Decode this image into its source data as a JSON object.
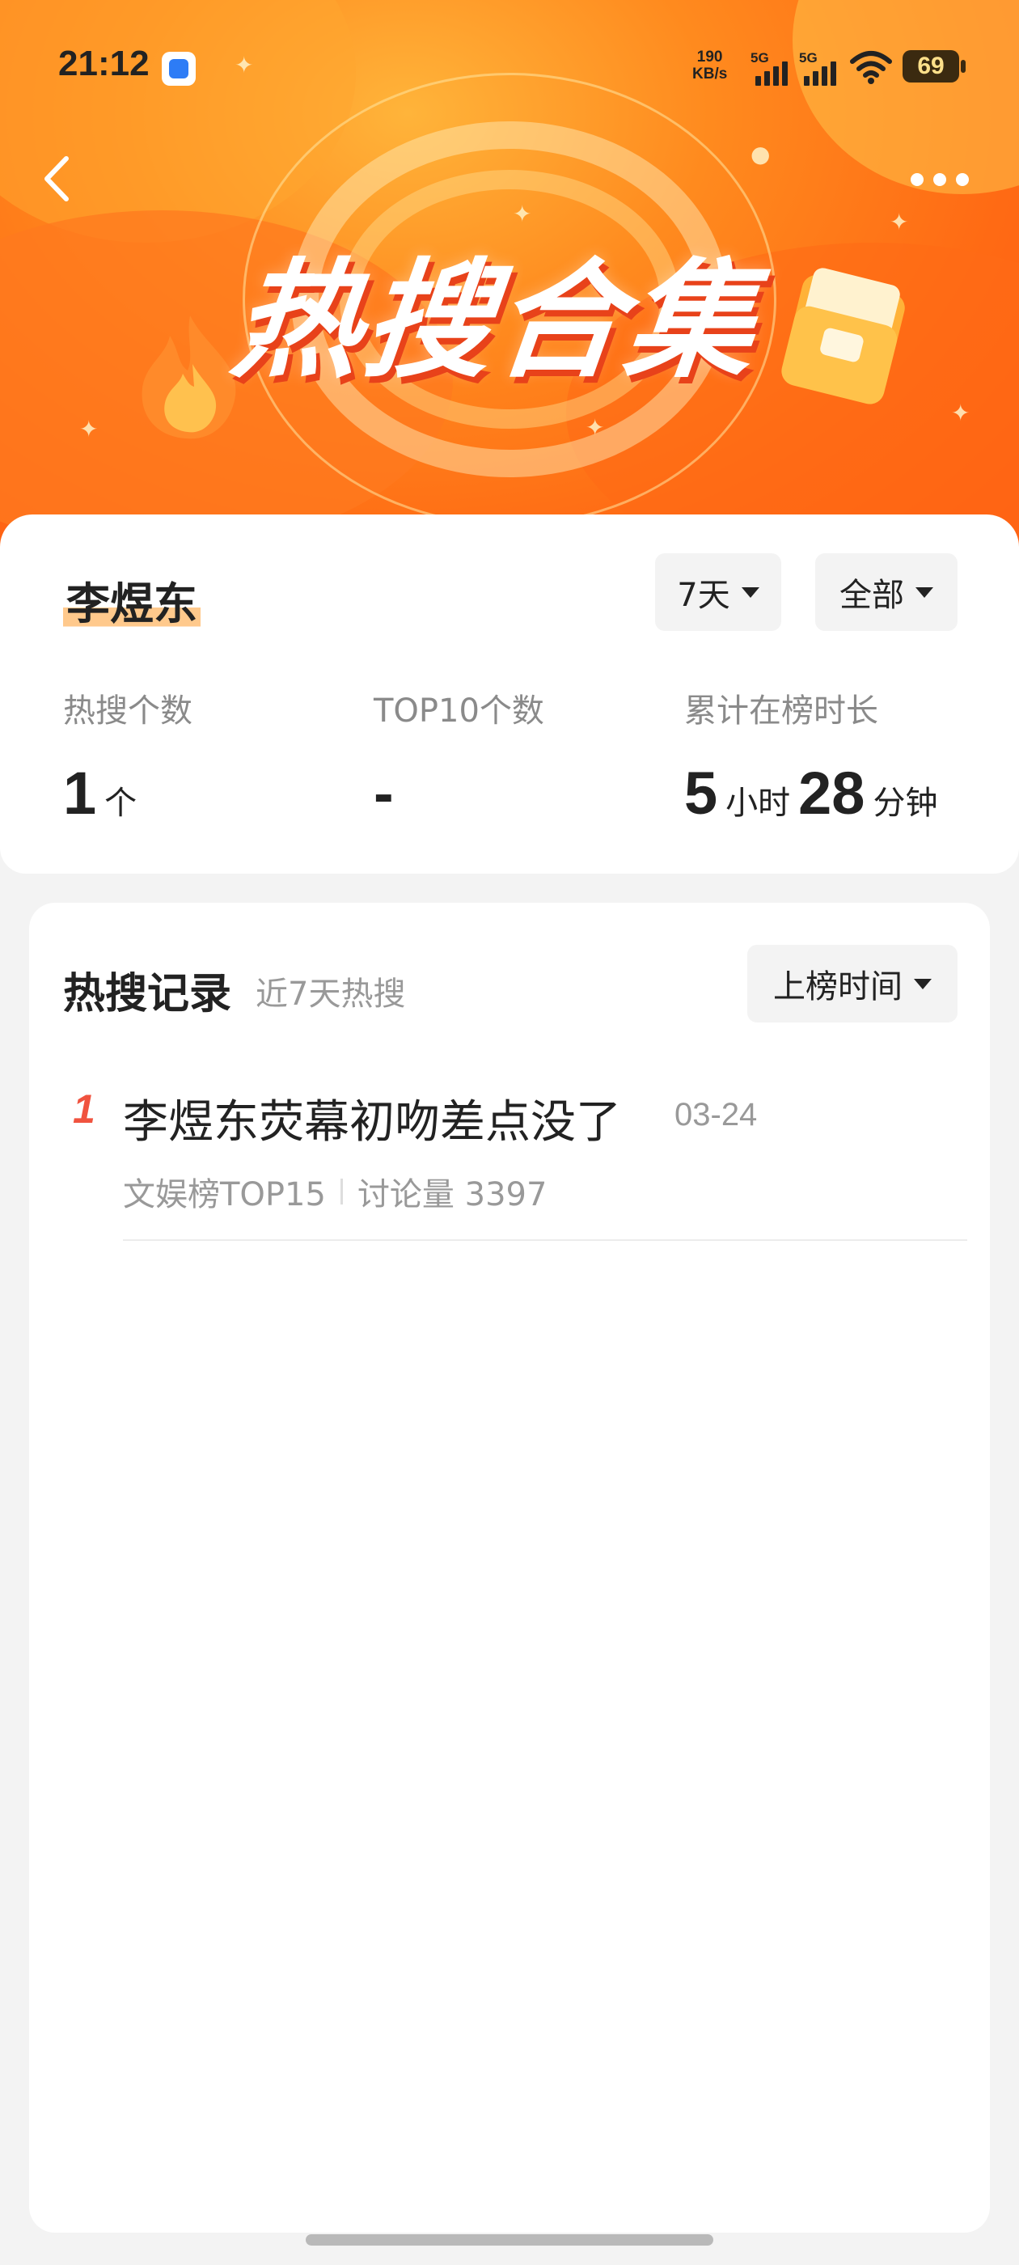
{
  "status_bar": {
    "time": "21:12",
    "net_speed_value": "190",
    "net_speed_unit": "KB/s",
    "sim1_label": "5G",
    "sim2_label": "5G",
    "battery": "69"
  },
  "banner": {
    "title": "热搜合集",
    "colors": {
      "primary": "#ff6a14",
      "accent": "#ffb43a",
      "title_shadow": "#e8421a"
    }
  },
  "person": {
    "name": "李煜东"
  },
  "filters": {
    "days_label": "7天",
    "category_label": "全部"
  },
  "stats": {
    "hot_count_label": "热搜个数",
    "hot_count_value": "1",
    "hot_count_unit": "个",
    "top10_label": "TOP10个数",
    "top10_value": "-",
    "duration_label": "累计在榜时长",
    "duration_hours": "5",
    "duration_hours_unit": "小时",
    "duration_minutes": "28",
    "duration_minutes_unit": "分钟"
  },
  "records": {
    "title": "热搜记录",
    "subtitle": "近7天热搜",
    "sort_label": "上榜时间",
    "items": [
      {
        "rank": "1",
        "title": "李煜东荧幕初吻差点没了",
        "date": "03-24",
        "board": "文娱榜TOP15",
        "discussion": "讨论量 3397"
      }
    ]
  },
  "icons": {
    "back": "chevron-left-icon",
    "more": "more-dots-icon",
    "dropdown": "caret-down-icon",
    "wifi": "wifi-icon",
    "battery": "battery-icon",
    "flame": "flame-icon",
    "folder": "folder-icon"
  }
}
